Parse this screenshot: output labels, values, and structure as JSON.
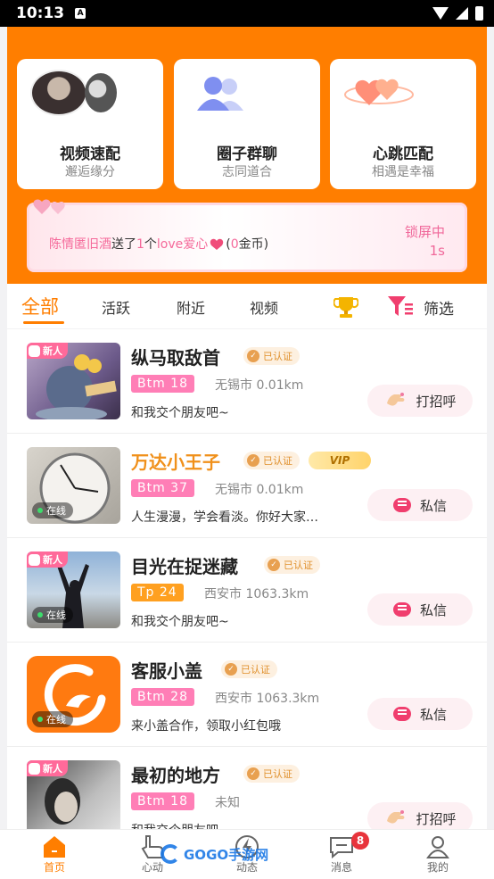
{
  "status_bar": {
    "time": "10:13",
    "notif_letter": "A"
  },
  "features": [
    {
      "title": "视频速配",
      "sub": "邂逅缘分"
    },
    {
      "title": "圈子群聊",
      "sub": "志同道合"
    },
    {
      "title": "心跳匹配",
      "sub": "相遇是幸福"
    }
  ],
  "banner": {
    "sender": "陈情匿旧酒",
    "mid1": "送了",
    "count": "1",
    "mid2": "个",
    "gift": "love爱心",
    "tail": "(",
    "coins": "0",
    "unit": "金币)",
    "lock_line1": "锁屏中",
    "lock_line2": "1s"
  },
  "tabs": {
    "all": "全部",
    "active": "活跃",
    "nearby": "附近",
    "video": "视频",
    "filter": "筛选"
  },
  "users": [
    {
      "name": "纵马取敌首",
      "verified": "已认证",
      "tag": "Btm  18",
      "location": "无锡市  0.01km",
      "bio": "和我交个朋友吧~",
      "action": "打招呼",
      "badge_new": "新人"
    },
    {
      "name": "万达小王子",
      "verified": "已认证",
      "vip": "VIP",
      "tag": "Btm  37",
      "location": "无锡市  0.01km",
      "bio": "人生漫漫，学会看淡。你好大家…",
      "action": "私信",
      "online": "在线"
    },
    {
      "name": "目光在捉迷藏",
      "verified": "已认证",
      "tag": "Tp  24",
      "location": "西安市  1063.3km",
      "bio": "和我交个朋友吧~",
      "action": "私信",
      "badge_new": "新人",
      "online": "在线"
    },
    {
      "name": "客服小盖",
      "verified": "已认证",
      "tag": "Btm  28",
      "location": "西安市  1063.3km",
      "bio": "来小盖合作，领取小红包哦",
      "action": "私信",
      "online": "在线"
    },
    {
      "name": "最初的地方",
      "verified": "已认证",
      "tag": "Btm  18",
      "location": "未知",
      "bio": "和我交个朋友吧",
      "action": "打招呼",
      "badge_new": "新人"
    }
  ],
  "nav": {
    "home": "首页",
    "heart": "心动",
    "dynamic": "动态",
    "messages": "消息",
    "messages_badge": "8",
    "mine": "我的"
  },
  "watermark": "GOGO手游网",
  "colors": {
    "brand_orange": "#ff7e00",
    "pink": "#ff7eb6",
    "badge_red": "#e8343c"
  }
}
